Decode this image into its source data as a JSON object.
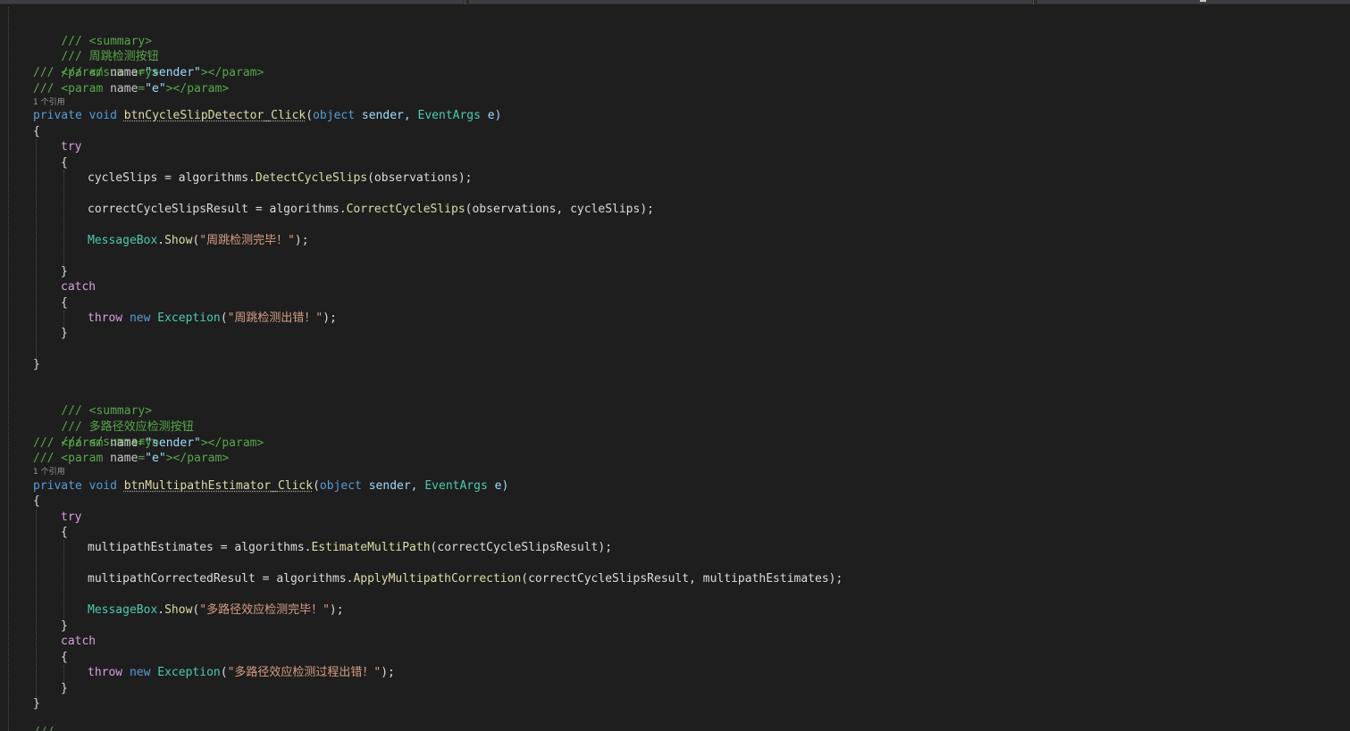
{
  "editor": {
    "theme_colors": {
      "background": "#1e1e1e",
      "comment": "#57a64a",
      "keyword": "#569cd6",
      "control": "#d8a0df",
      "type": "#4ec9b0",
      "method": "#dcdcaa",
      "string": "#d69d85",
      "text": "#dcdcdc"
    },
    "block1": {
      "c_summary_open": "/// <summary>",
      "c_desc": "/// 周跳检测按钮",
      "c_summary_close": "/// </summary>",
      "c_param_sender_pre": "/// <param ",
      "c_param_name_attr": "name",
      "c_param_eq": "=",
      "c_param_sender_val": "\"sender\"",
      "c_param_close": "></param>",
      "c_param_e_val": "\"e\"",
      "codelens": "1 个引用",
      "sig_private": "private",
      "sig_void": "void",
      "sig_name": "btnCycleSlipDetector_Click",
      "sig_open": "(",
      "sig_object": "object",
      "sig_sender": " sender, ",
      "sig_eventargs": "EventArgs",
      "sig_e": " e)",
      "brace_open": "{",
      "brace_close": "}",
      "kw_try": "try",
      "kw_catch": "catch",
      "l1_var": "cycleSlips",
      "l1_eq": " = ",
      "l1_obj": "algorithms",
      "l1_dot": ".",
      "l1_method": "DetectCycleSlips",
      "l1_args": "(observations);",
      "l2_var": "correctCycleSlipsResult",
      "l2_method": "CorrectCycleSlips",
      "l2_args": "(observations, cycleSlips);",
      "mb_type": "MessageBox",
      "mb_method": "Show",
      "mb_open": "(",
      "mb_str": "\"周跳检测完毕！\"",
      "mb_close": ");",
      "throw_kw": "throw",
      "new_kw": "new",
      "exc_type": "Exception",
      "exc_str": "\"周跳检测出错！\"",
      "exc_close": ");"
    },
    "block2": {
      "c_desc": "/// 多路径效应检测按钮",
      "sig_name": "btnMultipathEstimator_Click",
      "l1_var": "multipathEstimates",
      "l1_method": "EstimateMultiPath",
      "l1_args": "(correctCycleSlipsResult);",
      "l2_var": "multipathCorrectedResult",
      "l2_method": "ApplyMultipathCorrection",
      "l2_args": "(correctCycleSlipsResult, multipathEstimates);",
      "mb_str": "\"多路径效应检测完毕！\"",
      "exc_str": "\"多路径效应检测过程出错！\""
    },
    "trailing": "///"
  }
}
